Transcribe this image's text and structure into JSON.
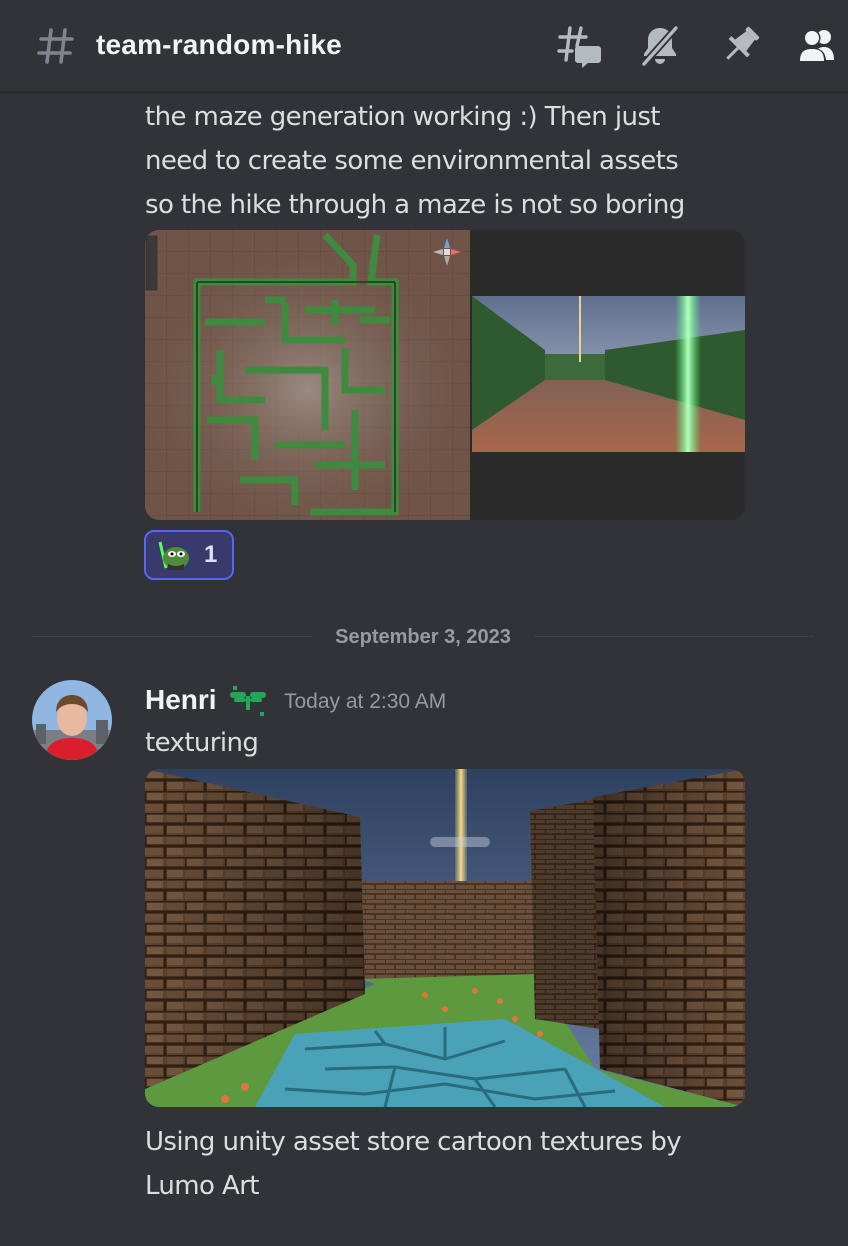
{
  "header": {
    "channel_name": "team-random-hike",
    "icons": [
      "hash-icon",
      "threads-icon",
      "mute-bell-icon",
      "pin-icon",
      "members-icon"
    ]
  },
  "messages": [
    {
      "text_lines": [
        "the maze generation working :) Then just",
        "need to create some environmental assets",
        "so the hike through a maze is not so boring"
      ],
      "reaction": {
        "emoji": "pepe-lightsaber-emoji",
        "count": "1"
      }
    },
    {
      "author": "Henri",
      "timestamp": "Today at 2:30 AM",
      "text": "texturing",
      "caption_lines": [
        "Using unity asset store cartoon textures by",
        "Lumo Art"
      ]
    }
  ],
  "date_divider": "September 3, 2023",
  "colors": {
    "background": "#313338",
    "text": "#dbdee1",
    "muted": "#949ba4",
    "reaction_border": "#5865f2",
    "reaction_bg": "#373a6b"
  }
}
